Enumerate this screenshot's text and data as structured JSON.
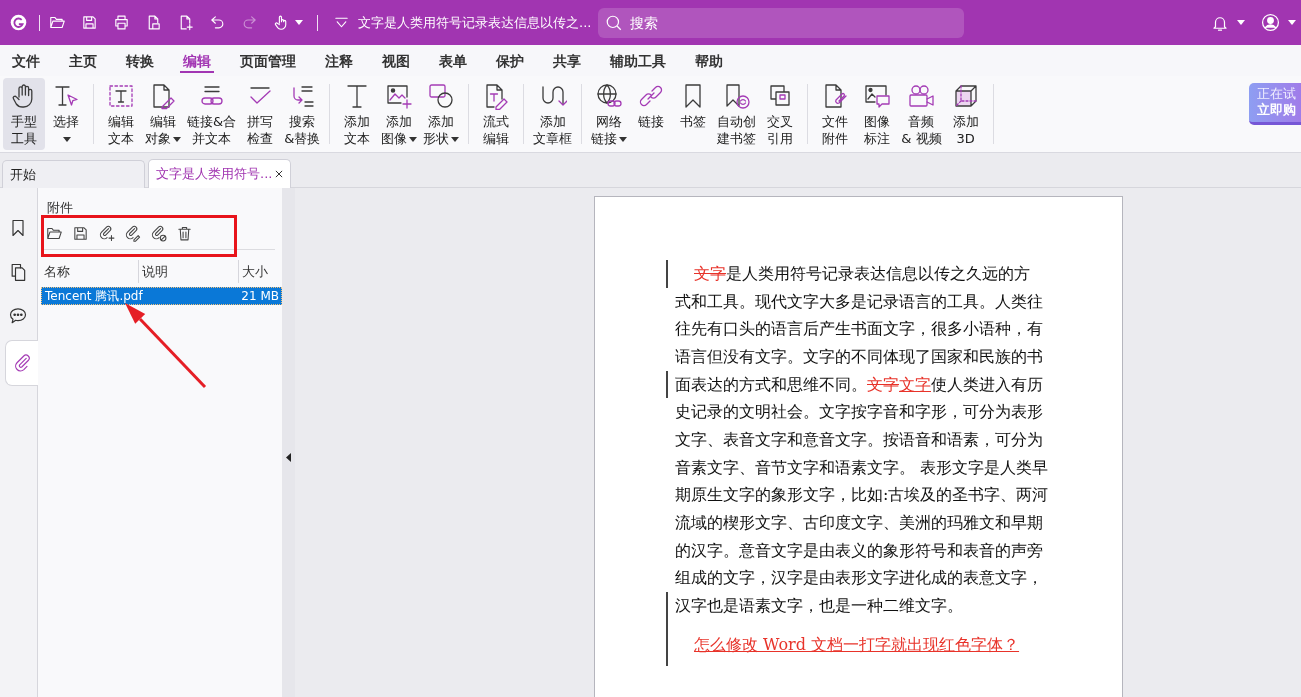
{
  "title_bar": {
    "quick_access": [
      {
        "kind": "open",
        "disabled": false
      },
      {
        "kind": "save",
        "disabled": false
      },
      {
        "kind": "print",
        "disabled": false
      },
      {
        "kind": "scan",
        "disabled": false
      },
      {
        "kind": "new",
        "disabled": false
      },
      {
        "kind": "undo",
        "disabled": false
      },
      {
        "kind": "redo",
        "disabled": true
      },
      {
        "kind": "touch",
        "disabled": false
      }
    ],
    "document_title": "文字是人类用符号记录表达信息以传之...",
    "search": {
      "placeholder": "搜索"
    }
  },
  "menu_tabs": [
    {
      "label": "文件",
      "selected": false
    },
    {
      "label": "主页",
      "selected": false
    },
    {
      "label": "转换",
      "selected": false
    },
    {
      "label": "编辑",
      "selected": true
    },
    {
      "label": "页面管理",
      "selected": false
    },
    {
      "label": "注释",
      "selected": false
    },
    {
      "label": "视图",
      "selected": false
    },
    {
      "label": "表单",
      "selected": false
    },
    {
      "label": "保护",
      "selected": false
    },
    {
      "label": "共享",
      "selected": false
    },
    {
      "label": "辅助工具",
      "selected": false
    },
    {
      "label": "帮助",
      "selected": false
    }
  ],
  "ribbon": [
    {
      "items": [
        {
          "kind": "hand",
          "lines": [
            "手型",
            "工具"
          ],
          "selected": true,
          "dropdown": false
        },
        {
          "kind": "select",
          "lines": [
            "选择"
          ],
          "selected": false,
          "dropdown": true
        }
      ]
    },
    {
      "items": [
        {
          "kind": "edittext",
          "lines": [
            "编辑",
            "文本"
          ],
          "selected": false,
          "dropdown": false
        },
        {
          "kind": "editobject",
          "lines": [
            "编辑",
            "对象"
          ],
          "selected": false,
          "dropdown": true
        },
        {
          "kind": "linkmerge",
          "lines": [
            "链接&合",
            "并文本"
          ],
          "selected": false,
          "dropdown": false
        },
        {
          "kind": "spellcheck",
          "lines": [
            "拼写",
            "检查"
          ],
          "selected": false,
          "dropdown": false
        },
        {
          "kind": "replace",
          "lines": [
            "搜索",
            "&替换"
          ],
          "selected": false,
          "dropdown": false
        }
      ]
    },
    {
      "items": [
        {
          "kind": "addtext",
          "lines": [
            "添加",
            "文本"
          ],
          "selected": false,
          "dropdown": false
        },
        {
          "kind": "addimage",
          "lines": [
            "添加",
            "图像"
          ],
          "selected": false,
          "dropdown": true
        },
        {
          "kind": "addshape",
          "lines": [
            "添加",
            "形状"
          ],
          "selected": false,
          "dropdown": true
        }
      ]
    },
    {
      "items": [
        {
          "kind": "flowedit",
          "lines": [
            "流式",
            "编辑"
          ],
          "selected": false,
          "dropdown": false
        }
      ]
    },
    {
      "items": [
        {
          "kind": "articlebox",
          "lines": [
            "添加",
            "文章框"
          ],
          "selected": false,
          "dropdown": false
        }
      ]
    },
    {
      "items": [
        {
          "kind": "weblink",
          "lines": [
            "网络",
            "链接"
          ],
          "selected": false,
          "dropdown": true
        },
        {
          "kind": "link",
          "lines": [
            "链接"
          ],
          "selected": false,
          "dropdown": false
        },
        {
          "kind": "bookmark",
          "lines": [
            "书签"
          ],
          "selected": false,
          "dropdown": false
        },
        {
          "kind": "autobookmark",
          "lines": [
            "自动创",
            "建书签"
          ],
          "selected": false,
          "dropdown": false
        },
        {
          "kind": "crossref",
          "lines": [
            "交叉",
            "引用"
          ],
          "selected": false,
          "dropdown": false
        }
      ]
    },
    {
      "items": [
        {
          "kind": "attachfile",
          "lines": [
            "文件",
            "附件"
          ],
          "selected": false,
          "dropdown": false
        },
        {
          "kind": "imagenote",
          "lines": [
            "图像",
            "标注"
          ],
          "selected": false,
          "dropdown": false
        },
        {
          "kind": "media",
          "lines": [
            "音频",
            "& 视频"
          ],
          "selected": false,
          "dropdown": false
        },
        {
          "kind": "add3d",
          "lines": [
            "添加",
            "3D"
          ],
          "selected": false,
          "dropdown": false
        }
      ]
    }
  ],
  "trial_button": {
    "lines": [
      "正在试",
      "立即购"
    ]
  },
  "document_tabs": [
    {
      "label": "开始",
      "selected": false,
      "closable": false
    },
    {
      "label": "文字是人类用符号...",
      "selected": true,
      "closable": true
    }
  ],
  "sidebar_tabs": [
    {
      "kind": "bookmarks",
      "selected": false
    },
    {
      "kind": "pages",
      "selected": false
    },
    {
      "kind": "comments",
      "selected": false
    },
    {
      "kind": "attachments",
      "selected": true
    }
  ],
  "attachments_panel": {
    "title": "附件",
    "columns": [
      "名称",
      "说明",
      "大小"
    ],
    "rows": [
      {
        "name": "Tencent 腾讯.pdf",
        "size": "21 MB",
        "selected": true
      }
    ]
  },
  "annotations": {
    "highlight_frame": true,
    "pointer_arrow": true
  },
  "document": {
    "paragraphs": [
      {
        "lines": [
          {
            "change_bar": true,
            "segments": [
              {
                "kind": "deleted",
                "text": "文字"
              },
              {
                "kind": "plain",
                "text": "是人类用符号记录表达信息以传之久远的方"
              }
            ]
          },
          {
            "change_bar": false,
            "segments": [
              {
                "kind": "plain",
                "text": "式和工具。现代文字大多是记录语言的工具。人类往"
              }
            ]
          },
          {
            "change_bar": false,
            "segments": [
              {
                "kind": "plain",
                "text": "往先有口头的语言后产生书面文字，很多小语种，有"
              }
            ]
          },
          {
            "change_bar": false,
            "segments": [
              {
                "kind": "plain",
                "text": "语言但没有文字。文字的不同体现了国家和民族的书"
              }
            ]
          },
          {
            "change_bar": true,
            "segments": [
              {
                "kind": "plain",
                "text": "面表达的方式和思维不同。"
              },
              {
                "kind": "deleted",
                "text": "文字"
              },
              {
                "kind": "inserted",
                "text": "文字"
              },
              {
                "kind": "plain",
                "text": "使人类进入有历"
              }
            ]
          },
          {
            "change_bar": false,
            "segments": [
              {
                "kind": "plain",
                "text": "史记录的文明社会。文字按字音和字形，可分为表形"
              }
            ]
          },
          {
            "change_bar": false,
            "segments": [
              {
                "kind": "plain",
                "text": "文字、表音文字和意音文字。按语音和语素，可分为"
              }
            ]
          },
          {
            "change_bar": false,
            "segments": [
              {
                "kind": "plain",
                "text": "音素文字、音节文字和语素文字。 表形文字是人类早"
              }
            ]
          },
          {
            "change_bar": false,
            "segments": [
              {
                "kind": "plain",
                "text": "期原生文字的象形文字，比如:古埃及的圣书字、两河"
              }
            ]
          },
          {
            "change_bar": false,
            "segments": [
              {
                "kind": "plain",
                "text": "流域的楔形文字、古印度文字、美洲的玛雅文和早期"
              }
            ]
          },
          {
            "change_bar": false,
            "segments": [
              {
                "kind": "plain",
                "text": "的汉字。意音文字是由表义的象形符号和表音的声旁"
              }
            ]
          },
          {
            "change_bar": false,
            "segments": [
              {
                "kind": "plain",
                "text": "组成的文字，汉字是由表形文字进化成的表意文字，"
              }
            ]
          },
          {
            "change_bar": true,
            "segments": [
              {
                "kind": "plain",
                "text": "汉字也是语素文字，也是一种二维文字。"
              }
            ]
          }
        ]
      },
      {
        "lines": [
          {
            "change_bar": true,
            "segments": [
              {
                "kind": "inserted",
                "text": "怎么修改 Word 文档一打字就出现红色字体？"
              }
            ]
          }
        ]
      }
    ]
  }
}
